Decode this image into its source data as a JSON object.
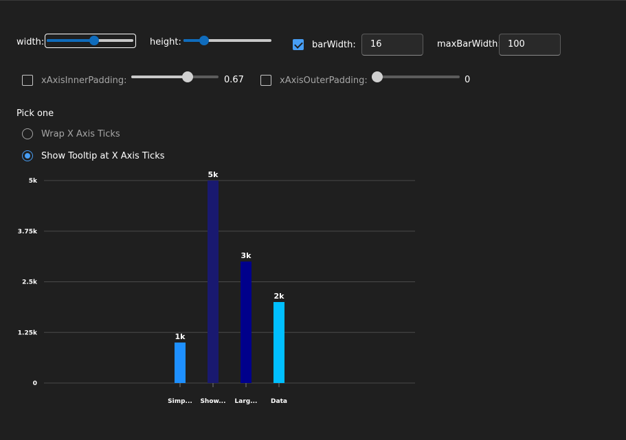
{
  "controls": {
    "width_label": "width:",
    "width_value": 0.55,
    "height_label": "height:",
    "height_value": 0.2,
    "barwidth_checked": true,
    "barwidth_label": "barWidth:",
    "barwidth_value": "16",
    "maxbarwidth_label": "maxBarWidth:",
    "maxbarwidth_value": "100",
    "inner_padding_checked": false,
    "inner_padding_label": "xAxisInnerPadding:",
    "inner_padding_value": 0.67,
    "inner_padding_display": "0.67",
    "outer_padding_checked": false,
    "outer_padding_label": "xAxisOuterPadding:",
    "outer_padding_value": 0,
    "outer_padding_display": "0"
  },
  "choice": {
    "heading": "Pick one",
    "options": [
      {
        "label": "Wrap X Axis Ticks",
        "selected": false
      },
      {
        "label": "Show Tooltip at X Axis Ticks",
        "selected": true
      }
    ]
  },
  "chart_data": {
    "type": "bar",
    "categories": [
      "Simp...",
      "Show...",
      "Larg...",
      "Data"
    ],
    "values": [
      1000,
      5000,
      3000,
      2000
    ],
    "data_labels": [
      "1k",
      "5k",
      "3k",
      "2k"
    ],
    "colors": [
      "#1e90ff",
      "#191970",
      "#00008b",
      "#00bfff"
    ],
    "ylim": [
      0,
      5000
    ],
    "yticks": [
      0,
      1250,
      2500,
      3750,
      5000
    ],
    "ytick_labels": [
      "0",
      "1.25k",
      "2.5k",
      "3.75k",
      "5k"
    ],
    "grid": true,
    "title": "",
    "xlabel": "",
    "ylabel": ""
  }
}
